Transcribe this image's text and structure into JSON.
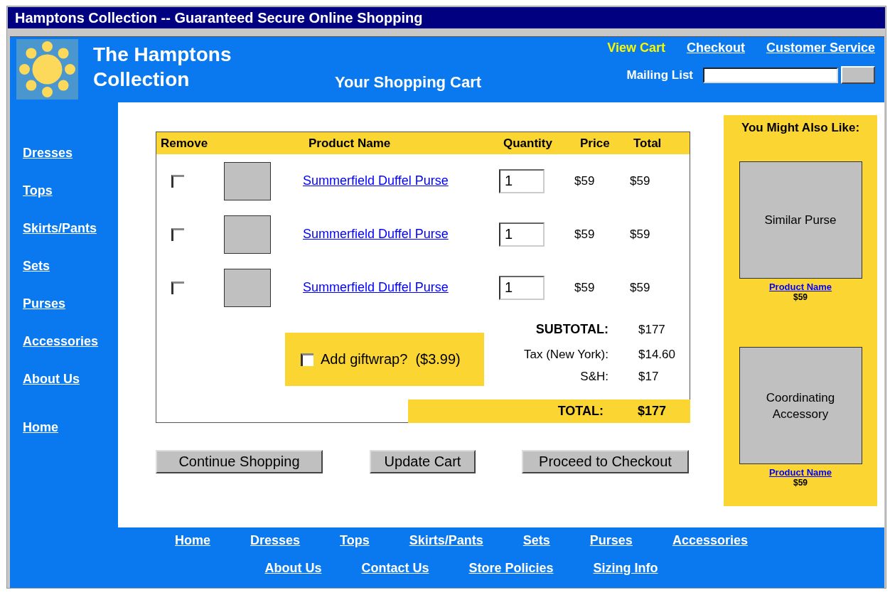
{
  "window": {
    "title": "Hamptons Collection -- Guaranteed Secure Online Shopping"
  },
  "header": {
    "site_name": "The Hamptons Collection",
    "page_title": "Your Shopping Cart",
    "top_links": [
      {
        "label": "View Cart",
        "selected": true
      },
      {
        "label": "Checkout",
        "selected": false
      },
      {
        "label": "Customer Service",
        "selected": false
      }
    ],
    "mailing_list": {
      "label": "Mailing List"
    }
  },
  "sidebar": {
    "items": [
      "Dresses",
      "Tops",
      "Skirts/Pants",
      "Sets",
      "Purses",
      "Accessories",
      "About Us",
      "Home"
    ]
  },
  "cart": {
    "columns": [
      "Remove",
      "Product Name",
      "Quantity",
      "Price",
      "Total"
    ],
    "rows": [
      {
        "remove": false,
        "product": "Summerfield Duffel Purse",
        "quantity": "1",
        "price": "$59",
        "total": "$59"
      },
      {
        "remove": false,
        "product": "Summerfield Duffel Purse",
        "quantity": "1",
        "price": "$59",
        "total": "$59"
      },
      {
        "remove": false,
        "product": "Summerfield Duffel Purse",
        "quantity": "1",
        "price": "$59",
        "total": "$59"
      }
    ],
    "giftwrap": {
      "label": "Add giftwrap?  ($3.99)",
      "checked": false
    },
    "summary": [
      {
        "kind": "bold",
        "label": "SUBTOTAL:",
        "value": "$177"
      },
      {
        "kind": "plain",
        "label": "Tax (New York):",
        "value": "$14.60"
      },
      {
        "kind": "plain",
        "label": "S&H:",
        "value": "$17"
      }
    ],
    "total": {
      "label": "TOTAL:",
      "value": "$177"
    }
  },
  "buttons": [
    "Continue Shopping",
    "Update Cart",
    "Proceed to Checkout"
  ],
  "recommendations": {
    "title": "You Might Also Like:",
    "items": [
      {
        "image_label": "Similar Purse",
        "name": "Product Name",
        "price": "$59"
      },
      {
        "image_label": "Coordinating Accessory",
        "name": "Product Name",
        "price": "$59"
      }
    ]
  },
  "footer": {
    "primary_links": [
      "Home",
      "Dresses",
      "Tops",
      "Skirts/Pants",
      "Sets",
      "Purses",
      "Accessories"
    ],
    "secondary_links": [
      "About Us",
      "Contact Us",
      "Store Policies",
      "Sizing Info"
    ]
  }
}
